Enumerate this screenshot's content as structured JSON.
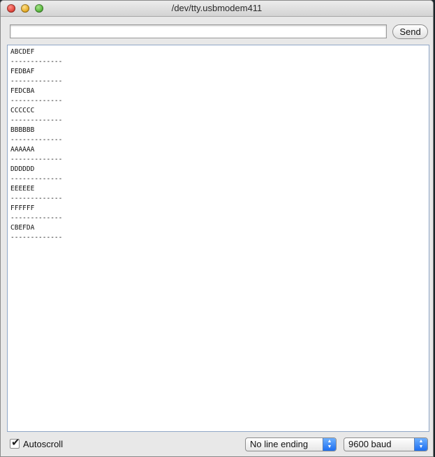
{
  "window": {
    "title": "/dev/tty.usbmodem411"
  },
  "input": {
    "value": "",
    "send_label": "Send"
  },
  "output": {
    "lines": [
      "ABCDEF",
      "-------------",
      "FEDBAF",
      "-------------",
      "FEDCBA",
      "-------------",
      "CCCCCC",
      "-------------",
      "BBBBBB",
      "-------------",
      "AAAAAA",
      "-------------",
      "DDDDDD",
      "-------------",
      "EEEEEE",
      "-------------",
      "FFFFFF",
      "-------------",
      "CBEFDA",
      "-------------"
    ]
  },
  "statusbar": {
    "autoscroll_label": "Autoscroll",
    "autoscroll_checked": true,
    "line_ending": "No line ending",
    "baud": "9600 baud"
  },
  "icons": {
    "close": "close-icon",
    "minimize": "minimize-icon",
    "zoom": "zoom-icon",
    "checkmark": "checkmark-icon",
    "updown": "updown-arrows-icon"
  },
  "colors": {
    "output_border": "#8fa7c7",
    "select_arrow": "#1d6ef0"
  }
}
